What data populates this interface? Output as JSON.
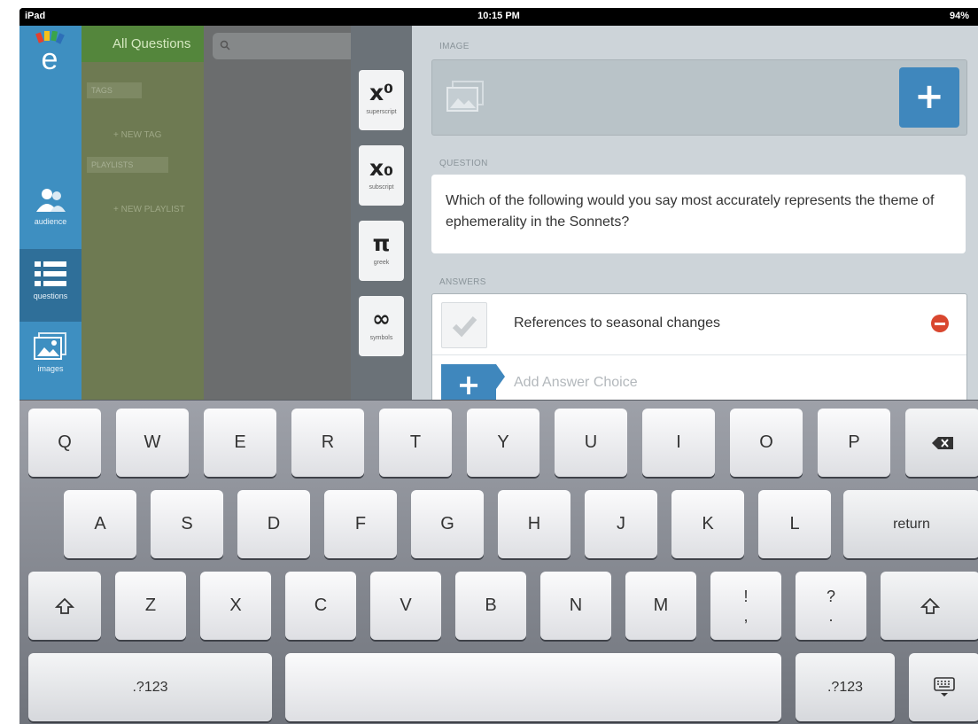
{
  "status_bar": {
    "device": "iPad",
    "time": "10:15 PM",
    "battery": "94%"
  },
  "rail": {
    "items": [
      {
        "label": "audience",
        "icon": "people-icon"
      },
      {
        "label": "questions",
        "icon": "list-icon"
      },
      {
        "label": "images",
        "icon": "images-icon"
      }
    ]
  },
  "tags_panel": {
    "header": "All Questions",
    "tags_label": "TAGS",
    "new_tag": "+ NEW TAG",
    "playlists_label": "PLAYLISTS",
    "new_playlist": "+ NEW PLAYLIST"
  },
  "format_toolbar": {
    "buttons": [
      {
        "symbol": "x⁰",
        "caption": "superscript"
      },
      {
        "symbol": "x₀",
        "caption": "subscript"
      },
      {
        "symbol": "π",
        "caption": "greek"
      },
      {
        "symbol": "∞",
        "caption": "symbols"
      }
    ]
  },
  "editor": {
    "image_label": "IMAGE",
    "add_image": "+",
    "question_label": "QUESTION",
    "question_text": "Which of the following would you say most accurately represents the theme of ephemerality in the Sonnets?",
    "answers_label": "ANSWERS",
    "answers": [
      {
        "text": "References to seasonal changes",
        "correct": true
      }
    ],
    "add_answer_icon": "+",
    "add_answer_label": "Add Answer Choice"
  },
  "keyboard": {
    "row1": [
      "Q",
      "W",
      "E",
      "R",
      "T",
      "Y",
      "U",
      "I",
      "O",
      "P"
    ],
    "row2": [
      "A",
      "S",
      "D",
      "F",
      "G",
      "H",
      "J",
      "K",
      "L"
    ],
    "return_label": "return",
    "row3": [
      "Z",
      "X",
      "C",
      "V",
      "B",
      "N",
      "M"
    ],
    "punct1_top": "!",
    "punct1_bottom": ",",
    "punct2_top": "?",
    "punct2_bottom": ".",
    "numbers_label": ".?123"
  },
  "colors": {
    "accent": "#3f87bd",
    "rail": "#3e8fc1",
    "tags_green": "#54863c",
    "remove_red": "#d9472f"
  }
}
